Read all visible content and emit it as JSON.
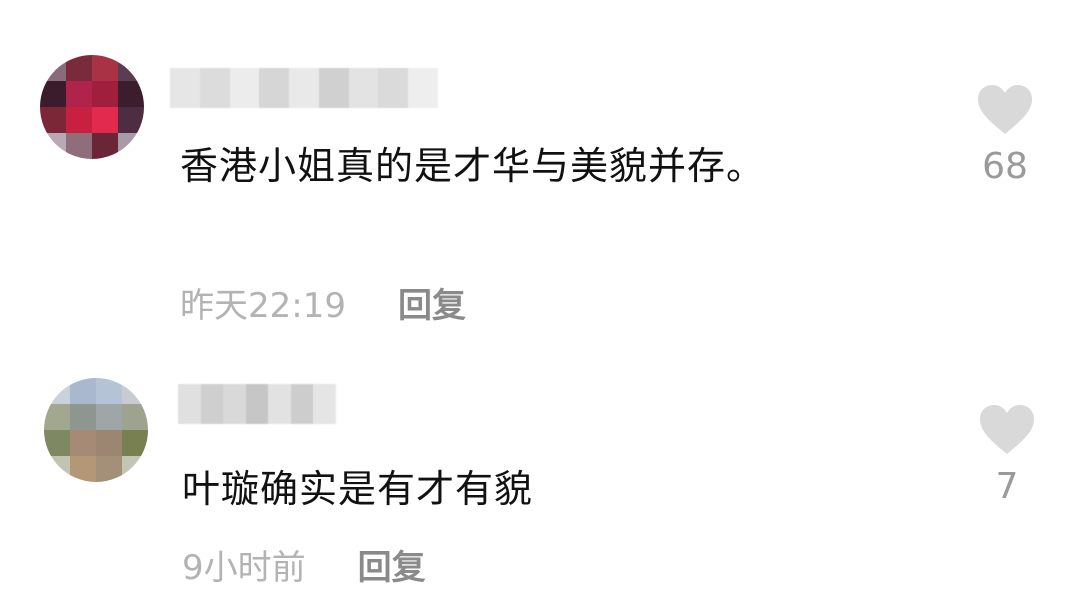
{
  "comments": [
    {
      "text": "香港小姐真的是才华与美貌并存。",
      "time": "昨天22:19",
      "reply_label": "回复",
      "like_count": "68",
      "icons": {
        "like": "heart-icon"
      },
      "avatar_colors": [
        "#8b6b7a",
        "#7a2a3a",
        "#a93245",
        "#5a3d52",
        "#3a1c2c",
        "#b0234a",
        "#a01f3c",
        "#3b1d2d",
        "#7c2737",
        "#c8203f",
        "#e22a4f",
        "#4c2d42",
        "#b9a9b4",
        "#8f6d7b",
        "#6a2536",
        "#a89aa7"
      ],
      "username_colors": [
        "#e6e6e6",
        "#dcdcdc",
        "#ececec",
        "#d6d6d6",
        "#e9e9e9",
        "#d0d0d0",
        "#e3e3e3",
        "#dadada",
        "#eeeeee"
      ]
    },
    {
      "text": "叶璇确实是有才有貌",
      "time": "9小时前",
      "reply_label": "回复",
      "like_count": "7",
      "icons": {
        "like": "heart-icon"
      },
      "avatar_colors": [
        "#c9d1dc",
        "#a9b8cf",
        "#b4c3d6",
        "#c8cbd2",
        "#a2a88f",
        "#8e9690",
        "#9fa6a7",
        "#9ea390",
        "#7f8961",
        "#a78a76",
        "#9c8672",
        "#78804f",
        "#c2c4b4",
        "#b39777",
        "#a48f78",
        "#c3c5b5"
      ],
      "username_colors": [
        "#e0e0e0",
        "#cfcfcf",
        "#d9d9d9",
        "#c6c6c6",
        "#e2e2e2",
        "#cdcdcd",
        "#e5e5e5"
      ]
    }
  ]
}
